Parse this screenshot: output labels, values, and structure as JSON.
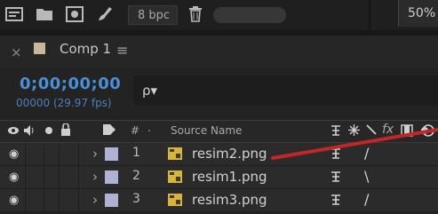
{
  "toolbar": {
    "bpc_label": "8 bpc",
    "zoom_label": "50%"
  },
  "panel": {
    "comp_tab_label": "Comp 1",
    "close_symbol": "×",
    "menu_symbol": "≡",
    "timecode": "0;00;00;00",
    "frame_info": "00000 (29.97 fps)",
    "search_placeholder": "ρ▾"
  },
  "header": {
    "hash_label": "#",
    "source_name_label": "Source Name",
    "fx_label": "fx"
  },
  "layers": [
    {
      "number": "1",
      "name": "resim2.png",
      "switch2": "/"
    },
    {
      "number": "2",
      "name": "resim1.png",
      "switch2": "\\"
    },
    {
      "number": "3",
      "name": "resim3.png",
      "switch2": "/"
    }
  ],
  "colors": {
    "timecode_blue": "#4a8fd8",
    "label_lavender": "#b1b1d6",
    "comp_swatch": "#c8b79a",
    "annotation_red": "#c0262a"
  },
  "icons": [
    "composition-icon",
    "folder-icon",
    "render-icon",
    "brush-icon",
    "trash-icon",
    "eye-icon",
    "audio-icon",
    "solo-icon",
    "lock-icon",
    "label-icon",
    "file-image-icon",
    "search-icon"
  ]
}
